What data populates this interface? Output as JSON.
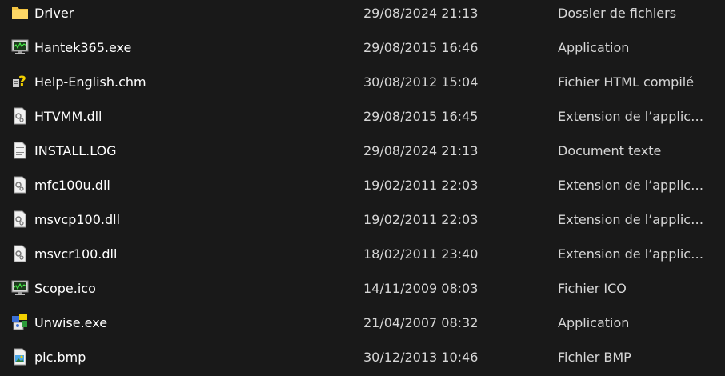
{
  "colors": {
    "background": "#191919",
    "name_text": "#ffffff",
    "secondary_text": "#d6d6d6",
    "folder": "#f4c542"
  },
  "files": [
    {
      "name": "Driver",
      "modified": "29/08/2024 21:13",
      "type": "Dossier de fichiers",
      "icon": "folder-icon"
    },
    {
      "name": "Hantek365.exe",
      "modified": "29/08/2015 16:46",
      "type": "Application",
      "icon": "monitor-app-icon"
    },
    {
      "name": "Help-English.chm",
      "modified": "30/08/2012 15:04",
      "type": "Fichier HTML compilé",
      "icon": "help-file-icon"
    },
    {
      "name": "HTVMM.dll",
      "modified": "29/08/2015 16:45",
      "type": "Extension de l’applica…",
      "icon": "dll-file-icon"
    },
    {
      "name": "INSTALL.LOG",
      "modified": "29/08/2024 21:13",
      "type": "Document texte",
      "icon": "text-file-icon"
    },
    {
      "name": "mfc100u.dll",
      "modified": "19/02/2011 22:03",
      "type": "Extension de l’applica…",
      "icon": "dll-file-icon"
    },
    {
      "name": "msvcp100.dll",
      "modified": "19/02/2011 22:03",
      "type": "Extension de l’applica…",
      "icon": "dll-file-icon"
    },
    {
      "name": "msvcr100.dll",
      "modified": "18/02/2011 23:40",
      "type": "Extension de l’applica…",
      "icon": "dll-file-icon"
    },
    {
      "name": "Scope.ico",
      "modified": "14/11/2009 08:03",
      "type": "Fichier ICO",
      "icon": "monitor-app-icon"
    },
    {
      "name": "Unwise.exe",
      "modified": "21/04/2007 08:32",
      "type": "Application",
      "icon": "installer-icon"
    },
    {
      "name": "pic.bmp",
      "modified": "30/12/2013 10:46",
      "type": "Fichier BMP",
      "icon": "image-file-icon"
    }
  ]
}
